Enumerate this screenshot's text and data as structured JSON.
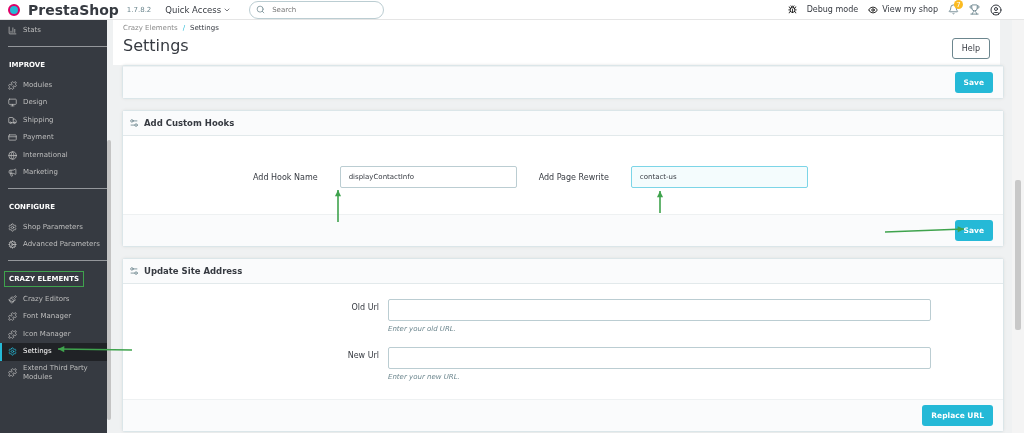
{
  "header": {
    "logo": "PrestaShop",
    "version": "1.7.8.2",
    "quick_access": "Quick Access",
    "search": {
      "placeholder": "Search"
    },
    "debug": "Debug mode",
    "view_shop": "View my shop",
    "notifications": "7"
  },
  "sidebar": {
    "top_item": {
      "label": "Stats",
      "selected": false
    },
    "sections": [
      {
        "title": "IMPROVE",
        "highlighted": false,
        "items": [
          {
            "label": "Modules",
            "selected": false
          },
          {
            "label": "Design",
            "selected": false
          },
          {
            "label": "Shipping",
            "selected": false
          },
          {
            "label": "Payment",
            "selected": false
          },
          {
            "label": "International",
            "selected": false
          },
          {
            "label": "Marketing",
            "selected": false
          }
        ]
      },
      {
        "title": "CONFIGURE",
        "highlighted": false,
        "items": [
          {
            "label": "Shop Parameters",
            "selected": false
          },
          {
            "label": "Advanced Parameters",
            "selected": false
          }
        ]
      },
      {
        "title": "CRAZY ELEMENTS",
        "highlighted": true,
        "items": [
          {
            "label": "Crazy Editors",
            "selected": false
          },
          {
            "label": "Font Manager",
            "selected": false
          },
          {
            "label": "Icon Manager",
            "selected": false
          },
          {
            "label": "Settings",
            "selected": true
          },
          {
            "label": "Extend Third Party Modules",
            "selected": false
          }
        ]
      }
    ]
  },
  "toolbar": {
    "breadcrumb": [
      "Crazy Elements",
      "Settings"
    ],
    "breadcrumb_separator": "/",
    "title": "Settings",
    "help": "Help"
  },
  "panels": [
    {
      "kind": "footer_only",
      "button": "Save"
    },
    {
      "kind": "inline",
      "title": "Add Custom Hooks",
      "fields": [
        {
          "label": "Add Hook Name",
          "value": "displayContactInfo",
          "focused": false
        },
        {
          "label": "Add Page Rewrite",
          "value": "contact-us",
          "focused": true
        }
      ],
      "button": "Save"
    },
    {
      "kind": "stacked",
      "title": "Update Site Address",
      "fields": [
        {
          "label": "Old Url",
          "hint": "Enter your old URL.",
          "focused": false
        },
        {
          "label": "New Url",
          "hint": "Enter your new URL.",
          "focused": false
        }
      ],
      "button": "Replace URL"
    }
  ]
}
